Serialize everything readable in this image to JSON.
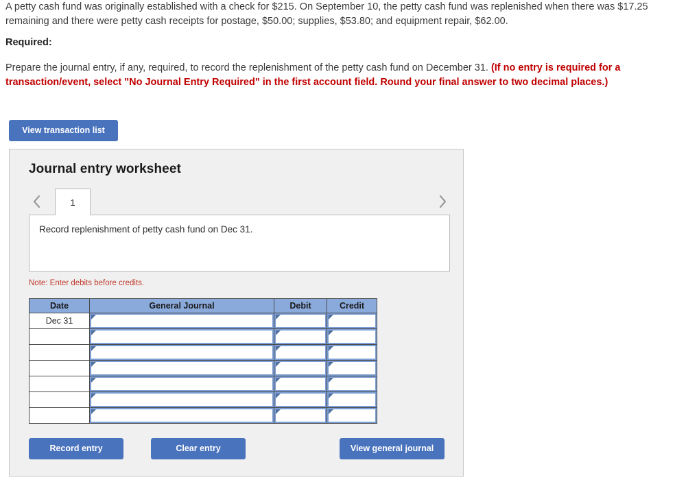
{
  "problem": {
    "statement": "A petty cash fund was originally established with a check for $215. On September 10, the petty cash fund was replenished when there was $17.25 remaining and there were petty cash receipts for postage, $50.00; supplies, $53.80; and equipment repair, $62.00."
  },
  "required": {
    "label": "Required:",
    "lead": "Prepare the journal entry, if any, required, to record the replenishment of the petty cash fund on December 31. ",
    "emphasis": "(If no entry is required for a transaction/event, select \"No Journal Entry Required\" in the first account field. Round your final answer to two decimal places.)"
  },
  "toolbar": {
    "view_transaction_list_label": "View transaction list"
  },
  "worksheet": {
    "title": "Journal entry worksheet",
    "prev_icon": "chevron-left-icon",
    "next_icon": "chevron-right-icon",
    "tabs": [
      {
        "label": "1",
        "active": true
      }
    ],
    "description": "Record replenishment of petty cash fund on Dec 31.",
    "note": "Note: Enter debits before credits.",
    "table": {
      "headers": [
        "Date",
        "General Journal",
        "Debit",
        "Credit"
      ],
      "rows": [
        {
          "date": "Dec 31",
          "general_journal": "",
          "debit": "",
          "credit": ""
        },
        {
          "date": "",
          "general_journal": "",
          "debit": "",
          "credit": ""
        },
        {
          "date": "",
          "general_journal": "",
          "debit": "",
          "credit": ""
        },
        {
          "date": "",
          "general_journal": "",
          "debit": "",
          "credit": ""
        },
        {
          "date": "",
          "general_journal": "",
          "debit": "",
          "credit": ""
        },
        {
          "date": "",
          "general_journal": "",
          "debit": "",
          "credit": ""
        },
        {
          "date": "",
          "general_journal": "",
          "debit": "",
          "credit": ""
        }
      ]
    },
    "actions": {
      "record_entry_label": "Record entry",
      "clear_entry_label": "Clear entry",
      "view_general_journal_label": "View general journal"
    }
  },
  "colors": {
    "button_blue": "#4a73bd",
    "table_header_blue": "#8aaadc",
    "cell_border_blue": "#7c9ed4",
    "alert_red": "#c00000",
    "note_red": "#c0392b",
    "panel_background": "#f0f0f0"
  }
}
